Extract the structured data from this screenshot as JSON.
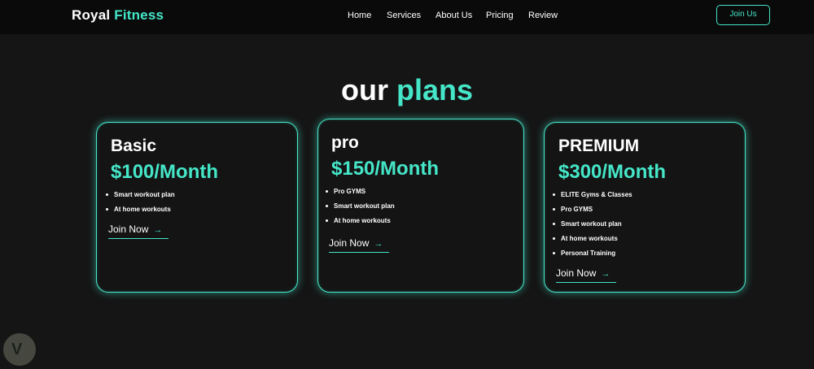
{
  "header": {
    "logo_first": "Royal",
    "logo_second": "Fitness",
    "nav": [
      "Home",
      "Services",
      "About Us",
      "Pricing",
      "Review"
    ],
    "cta": "Join Us"
  },
  "section": {
    "title_first": "our",
    "title_second": "plans"
  },
  "plans": [
    {
      "name": "Basic",
      "price": "$100/Month",
      "features": [
        "Smart workout plan",
        "At home workouts"
      ],
      "cta": "Join Now"
    },
    {
      "name": "pro",
      "price": "$150/Month",
      "features": [
        "Pro GYMS",
        "Smart workout plan",
        "At home workouts"
      ],
      "cta": "Join Now"
    },
    {
      "name": "PREMIUM",
      "price": "$300/Month",
      "features": [
        "ELITE Gyms & Classes",
        "Pro GYMS",
        "Smart workout plan",
        "At home workouts",
        "Personal Training"
      ],
      "cta": "Join Now"
    }
  ],
  "colors": {
    "accent": "#45e6c8",
    "background": "#151515",
    "header": "#0a0a0a"
  },
  "icons": {
    "arrow": "arrow-right-icon"
  }
}
